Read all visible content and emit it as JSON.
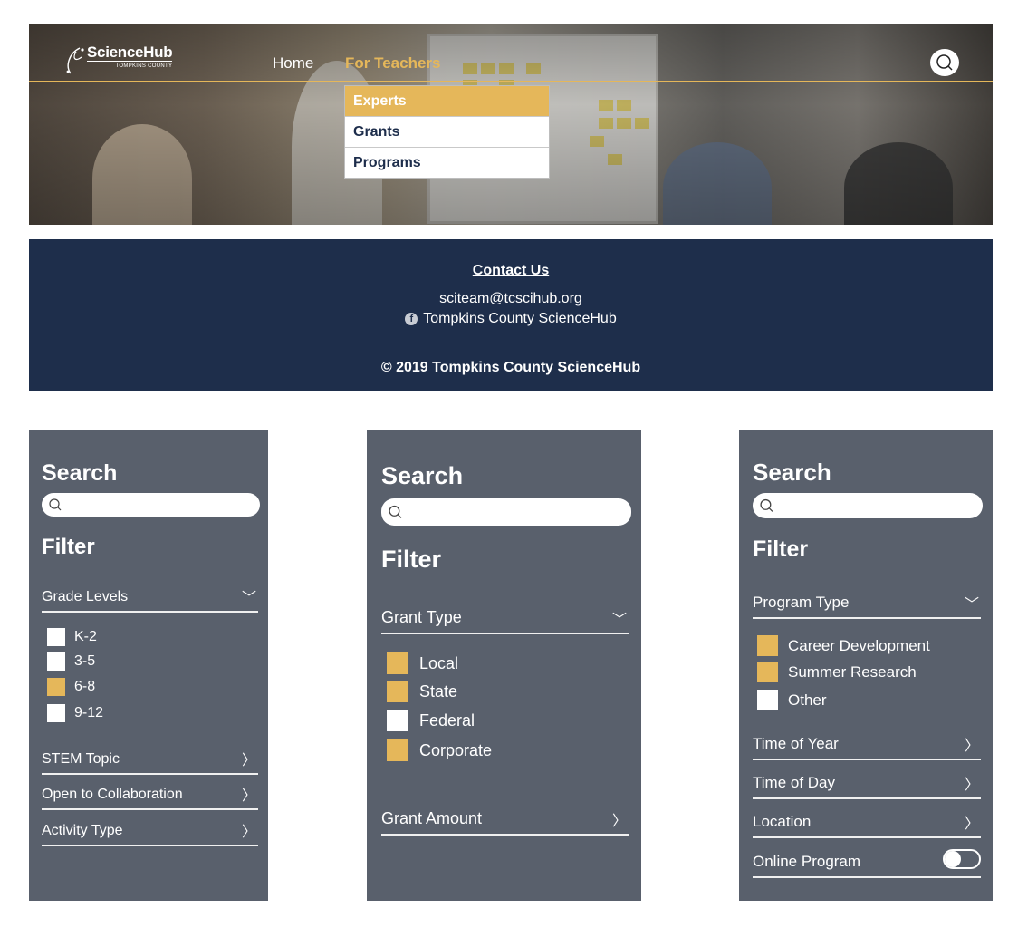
{
  "header": {
    "logo_title": "ScienceHub",
    "logo_subtitle": "TOMPKINS COUNTY",
    "nav": {
      "home": "Home",
      "for_teachers": "For Teachers"
    },
    "dropdown": [
      "Experts",
      "Grants",
      "Programs"
    ]
  },
  "footer": {
    "contact": "Contact Us",
    "email": "sciteam@tcscihub.org",
    "facebook": "Tompkins County ScienceHub",
    "copyright": "© 2019 Tompkins County ScienceHub"
  },
  "panels": {
    "experts": {
      "search_title": "Search",
      "filter_title": "Filter",
      "group": "Grade Levels",
      "options": [
        {
          "label": "K-2",
          "checked": false
        },
        {
          "label": "3-5",
          "checked": false
        },
        {
          "label": "6-8",
          "checked": true
        },
        {
          "label": "9-12",
          "checked": false
        }
      ],
      "rows": [
        "STEM Topic",
        "Open to Collaboration",
        "Activity Type"
      ]
    },
    "grants": {
      "search_title": "Search",
      "filter_title": "Filter",
      "group": "Grant Type",
      "options": [
        {
          "label": "Local",
          "checked": true
        },
        {
          "label": "State",
          "checked": true
        },
        {
          "label": "Federal",
          "checked": false
        },
        {
          "label": "Corporate",
          "checked": true
        }
      ],
      "rows": [
        "Grant Amount"
      ]
    },
    "programs": {
      "search_title": "Search",
      "filter_title": "Filter",
      "group": "Program Type",
      "options": [
        {
          "label": "Career Development",
          "checked": true
        },
        {
          "label": "Summer Research",
          "checked": true
        },
        {
          "label": "Other",
          "checked": false
        }
      ],
      "rows": [
        "Time of Year",
        "Time of Day",
        "Location"
      ],
      "toggle_label": "Online Program",
      "toggle_on": false
    }
  },
  "colors": {
    "accent": "#e5b75a",
    "navy": "#1e2e4b",
    "panel": "#59606c"
  }
}
